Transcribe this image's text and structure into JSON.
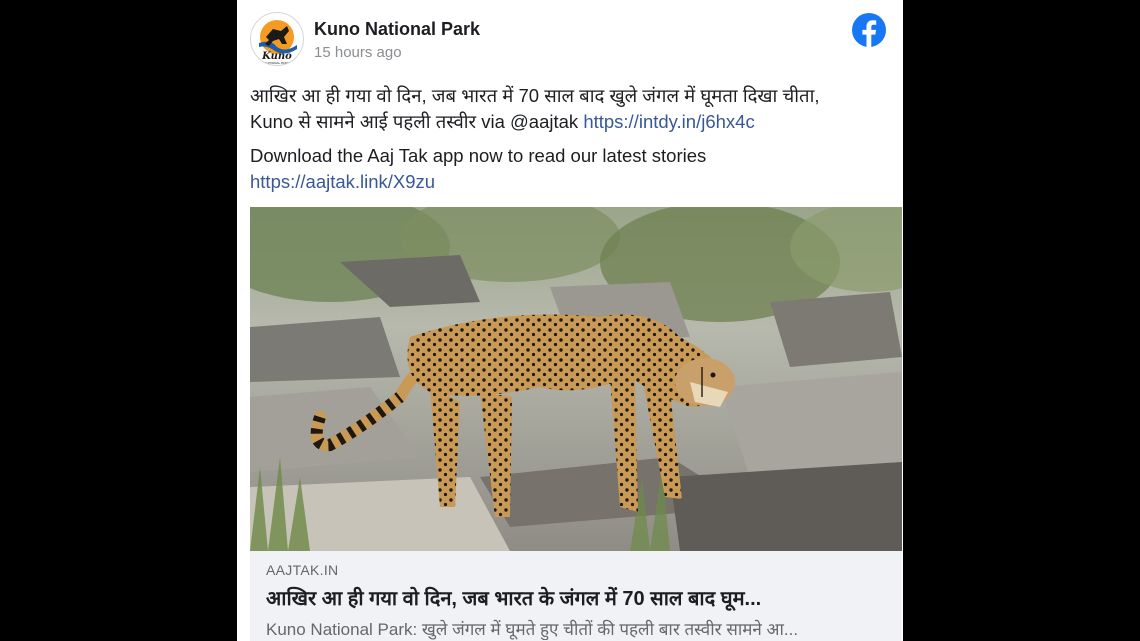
{
  "post": {
    "author": "Kuno National Park",
    "timestamp": "15 hours ago",
    "logo_text": "Kuno",
    "logo_subtext": "NATIONAL PARK",
    "platform_icon": "facebook-icon",
    "text_line1": "आखिर आ ही गया वो दिन, जब भारत में 70 साल बाद खुले जंगल में घूमता दिखा चीता,",
    "text_line2_prefix": "Kuno से सामने आई पहली तस्वीर via @aajtak",
    "text_link": "https://intdy.in/j6hx4c",
    "cta_text": "Download the Aaj Tak app now to read our latest stories",
    "cta_link": "https://aajtak.link/X9zu"
  },
  "preview": {
    "domain": "AAJTAK.IN",
    "headline": "आखिर आ ही गया वो दिन, जब भारत के जंगल में 70 साल बाद घूम...",
    "description": "Kuno National Park: खुले जंगल में घूमते हुए चीतों की पहली बार तस्वीर सामने आ..."
  },
  "colors": {
    "facebook_blue": "#1877f2",
    "link_blue": "#385898",
    "page_bg": "#000000"
  }
}
